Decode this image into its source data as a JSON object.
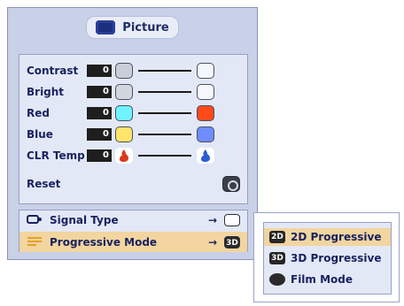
{
  "title": "Picture",
  "settings": [
    {
      "label": "Contrast",
      "value": "0",
      "left_icon": "circle-gray",
      "right_icon": "square-light"
    },
    {
      "label": "Bright",
      "value": "0",
      "left_icon": "sun-gray",
      "right_icon": "sun-white"
    },
    {
      "label": "Red",
      "value": "0",
      "left_icon": "circle-cyan",
      "right_icon": "circle-red"
    },
    {
      "label": "Blue",
      "value": "0",
      "left_icon": "circle-yellow",
      "right_icon": "circle-blue"
    },
    {
      "label": "CLR Temp",
      "value": "0",
      "left_icon": "flame-red",
      "right_icon": "flame-blue"
    }
  ],
  "reset": {
    "label": "Reset"
  },
  "signal_type": {
    "label": "Signal Type"
  },
  "progressive_mode": {
    "label": "Progressive Mode",
    "badge": "3D"
  },
  "submenu": [
    {
      "label": "2D Progressive",
      "tag": "2D"
    },
    {
      "label": "3D Progressive",
      "tag": "3D"
    },
    {
      "label": "Film Mode",
      "tag": ""
    }
  ],
  "colors": {
    "panel_bg": "#c9d1e8",
    "highlight": "#f2d59f",
    "text": "#18225f"
  }
}
